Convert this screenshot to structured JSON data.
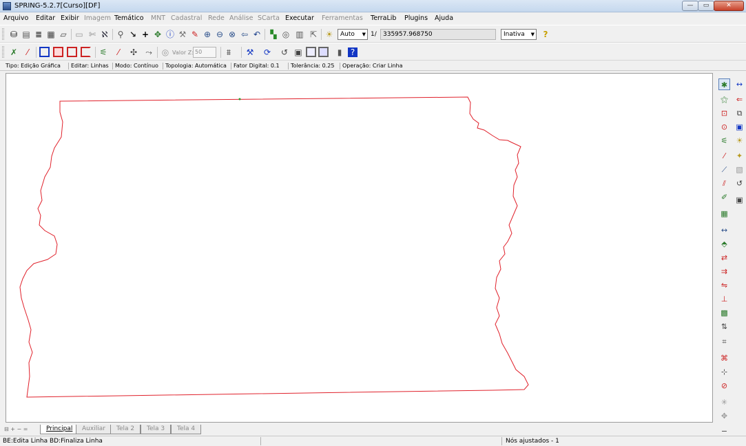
{
  "window": {
    "title": "SPRING-5.2.7[Curso][DF]",
    "minimize": "—",
    "maximize": "▭",
    "close": "✕"
  },
  "menu": {
    "arquivo": "Arquivo",
    "editar": "Editar",
    "exibir": "Exibir",
    "imagem": "Imagem",
    "tematico": "Temático",
    "mnt": "MNT",
    "cadastral": "Cadastral",
    "rede": "Rede",
    "analise": "Análise",
    "scarta": "SCarta",
    "executar": "Executar",
    "ferramentas": "Ferramentas",
    "terralib": "TerraLib",
    "plugins": "Plugins",
    "ajuda": "Ajuda"
  },
  "toolbar": {
    "zoom_mode": "Auto",
    "scale_prefix": "1/",
    "scale_value": "335957.968750",
    "state": "Inativa",
    "valor_z_label": "Valor Z:",
    "valor_z_value": "50"
  },
  "edit_status": {
    "tipo": "Tipo: Edição Gráfica",
    "editar": "Editar: Linhas",
    "modo": "Modo: Contínuo",
    "topologia": "Topologia: Automática",
    "fator": "Fator Digital: 0.1",
    "tolerancia": "Tolerância: 0.25",
    "operacao": "Operação: Criar Linha"
  },
  "tabs": {
    "principal": "Principal",
    "auxiliar": "Auxiliar",
    "tela2": "Tela 2",
    "tela3": "Tela 3",
    "tela4": "Tela 4",
    "nav": "⊟ + − ="
  },
  "statusbar": {
    "left": "BE:Edita Linha  BD:Finaliza Linha",
    "right": "Nós ajustados - 1"
  },
  "colors": {
    "line": "#e0202a",
    "node": "#2a9a2a",
    "accent": "#1236c4"
  },
  "icons": {
    "db": "database-icon",
    "help": "help-icon",
    "info": "info-icon"
  }
}
